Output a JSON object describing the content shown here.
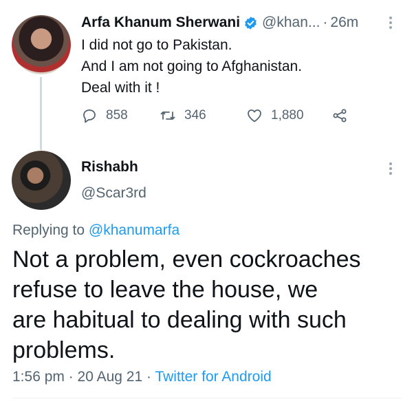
{
  "tweet1": {
    "name": "Arfa Khanum Sherwani",
    "handle": "@khan...",
    "separator": "·",
    "time": "26m",
    "text_lines": [
      "I did not go to Pakistan.",
      "And I am not going to Afghanistan.",
      "Deal with it !"
    ],
    "replies": "858",
    "retweets": "346",
    "likes": "1,880"
  },
  "tweet2": {
    "name": "Rishabh",
    "handle": "@Scar3rd",
    "replying_prefix": "Replying to",
    "replying_to": "@khanumarfa",
    "text_lines": [
      "Not a problem, even cockroaches",
      "refuse to leave the house, we",
      "are habitual to dealing with such",
      "problems."
    ],
    "timestamp": "1:56 pm · 20 Aug 21 ·",
    "client": "Twitter for Android"
  },
  "colors": {
    "accent": "#1d9bf0",
    "secondary_text": "#536471",
    "primary_text": "#0f1419"
  },
  "icons": [
    "verified-badge-icon",
    "more-icon",
    "reply-icon",
    "retweet-icon",
    "like-icon",
    "share-icon"
  ]
}
